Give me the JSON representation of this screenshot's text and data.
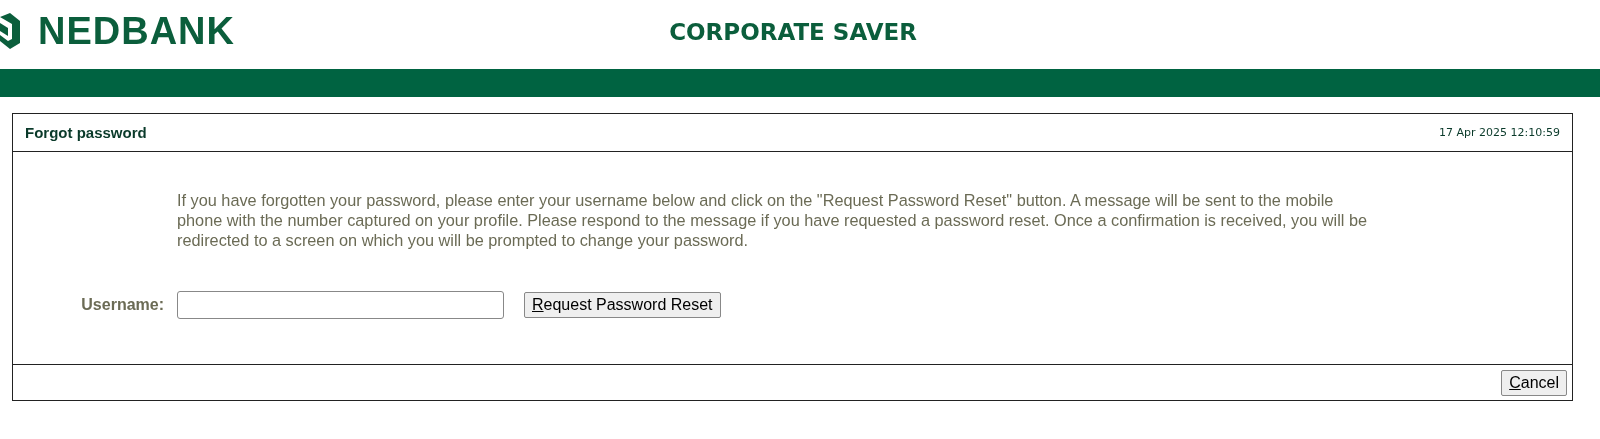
{
  "header": {
    "logo": "NEDBANK",
    "title": "CORPORATE SAVER"
  },
  "panel": {
    "title": "Forgot password",
    "timestamp": "17 Apr 2025 12:10:59",
    "instructions": "If you have forgotten your password, please enter your username below and click on the \"Request Password Reset\" button. A message will be sent to the mobile phone with the number captured on your profile. Please respond to the message if you have requested a password reset. Once a confirmation is received, you will be redirected to a screen on which you will be prompted to change your password.",
    "username_label": "Username:",
    "submit_button": "Request Password Reset",
    "cancel_button": "Cancel"
  }
}
